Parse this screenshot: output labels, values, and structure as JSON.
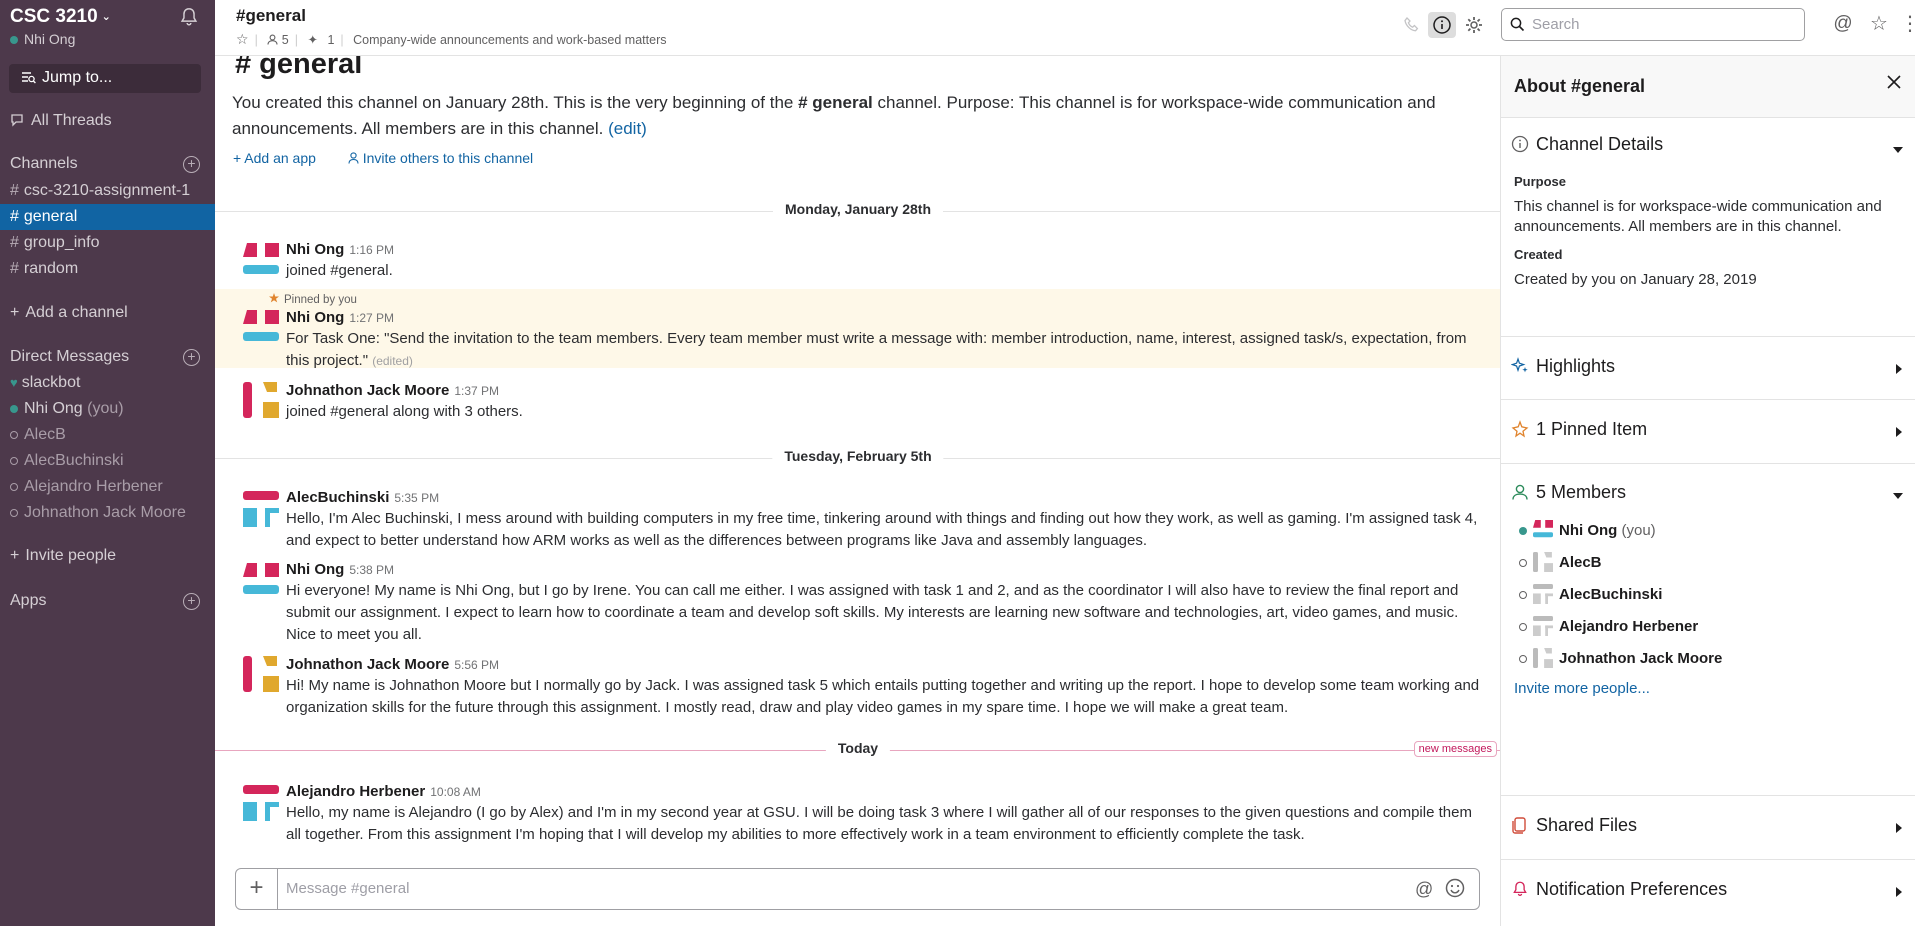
{
  "sidebar": {
    "workspace": "CSC 3210",
    "user": "Nhi Ong",
    "jump": "Jump to...",
    "all_threads": "All Threads",
    "channels_heading": "Channels",
    "channels": [
      {
        "name": "csc-3210-assignment-1"
      },
      {
        "name": "general"
      },
      {
        "name": "group_info"
      },
      {
        "name": "random"
      }
    ],
    "add_channel": "Add a channel",
    "dm_heading": "Direct Messages",
    "dms": [
      {
        "name": "slackbot"
      },
      {
        "name": "Nhi Ong",
        "suffix": "(you)"
      },
      {
        "name": "AlecB"
      },
      {
        "name": "AlecBuchinski"
      },
      {
        "name": "Alejandro Herbener"
      },
      {
        "name": "Johnathon Jack Moore"
      }
    ],
    "invite_people": "Invite people",
    "apps_heading": "Apps"
  },
  "header": {
    "channel": "#general",
    "members_count": "5",
    "pins_count": "1",
    "topic": "Company-wide announcements and work-based matters",
    "search_placeholder": "Search"
  },
  "intro": {
    "title": "# general",
    "text_1": "You created this channel on January 28th. This is the very beginning of the ",
    "channel_ref": "# general",
    "text_2": " channel. Purpose: This channel is for workspace-wide communication and announcements. All members are in this channel. ",
    "edit": "(edit)",
    "add_app": "Add an app",
    "invite_others": "Invite others to this channel"
  },
  "days": {
    "d1": "Monday, January 28th",
    "d2": "Tuesday, February 5th",
    "d3": "Today",
    "new_messages": "new messages"
  },
  "messages": [
    {
      "author": "Nhi Ong",
      "time": "1:16 PM",
      "text": "joined #general."
    },
    {
      "pinned_label": "Pinned by you",
      "author": "Nhi Ong",
      "time": "1:27 PM",
      "text": "For Task One: \"Send the invitation to the team members. Every team member must write a message with:  member introduction, name, interest, assigned task/s, expectation, from this project.\"",
      "edited": "(edited)"
    },
    {
      "author": "Johnathon Jack Moore",
      "time": "1:37 PM",
      "text": "joined #general along with 3 others."
    },
    {
      "author": "AlecBuchinski",
      "time": "5:35 PM",
      "text": "Hello, I'm Alec Buchinski, I mess around with building computers in my free time, tinkering around with things and finding out how they work, as well as gaming. I'm assigned task 4, and expect to better understand how ARM works as well as the differences between programs like Java and assembly languages."
    },
    {
      "author": "Nhi Ong",
      "time": "5:38 PM",
      "text": "Hi everyone! My name is Nhi Ong, but I go by Irene. You can call me either. I was assigned with task 1 and 2, and as the coordinator I will also have to review the final report and submit our assignment. I expect to learn how to coordinate a team and develop soft skills. My interests are learning new software and technologies, art, video games, and music. Nice to meet you all."
    },
    {
      "author": "Johnathon Jack Moore",
      "time": "5:56 PM",
      "text": "Hi! My name is Johnathon Moore but I normally go by Jack. I was assigned task 5 which entails putting together and writing up the report. I hope to develop some team working and organization skills for the future through this assignment. I mostly read, draw and play video games in my spare time. I hope we will make a great team."
    },
    {
      "author": "Alejandro Herbener",
      "time": "10:08 AM",
      "text": "Hello, my name is Alejandro (I go by Alex) and I'm in my second year at GSU. I will be doing task 3 where I will gather all of our responses to the given questions and compile them all together. From this assignment I'm hoping that I will develop my abilities to more effectively work in a team environment to efficiently complete the task."
    }
  ],
  "composer": {
    "placeholder": "Message #general"
  },
  "panel": {
    "title": "About #general",
    "details_heading": "Channel Details",
    "purpose_label": "Purpose",
    "purpose": "This channel is for workspace-wide communication and announcements. All members are in this channel.",
    "created_label": "Created",
    "created": "Created by you on January 28, 2019",
    "highlights": "Highlights",
    "pinned": "1 Pinned Item",
    "members_heading": "5 Members",
    "members": [
      {
        "name": "Nhi Ong",
        "suffix": "(you)"
      },
      {
        "name": "AlecB"
      },
      {
        "name": "AlecBuchinski"
      },
      {
        "name": "Alejandro Herbener"
      },
      {
        "name": "Johnathon Jack Moore"
      }
    ],
    "invite_more": "Invite more people...",
    "shared_files": "Shared Files",
    "notifications": "Notification Preferences"
  },
  "colors": {
    "sidebar": "#4d394b",
    "active": "#1164a3",
    "link": "#1264a3",
    "pinned_bg": "#fef8e8",
    "avatar_red": "#d4265b",
    "avatar_blue": "#46b8d8",
    "avatar_gold": "#e0a82e"
  }
}
